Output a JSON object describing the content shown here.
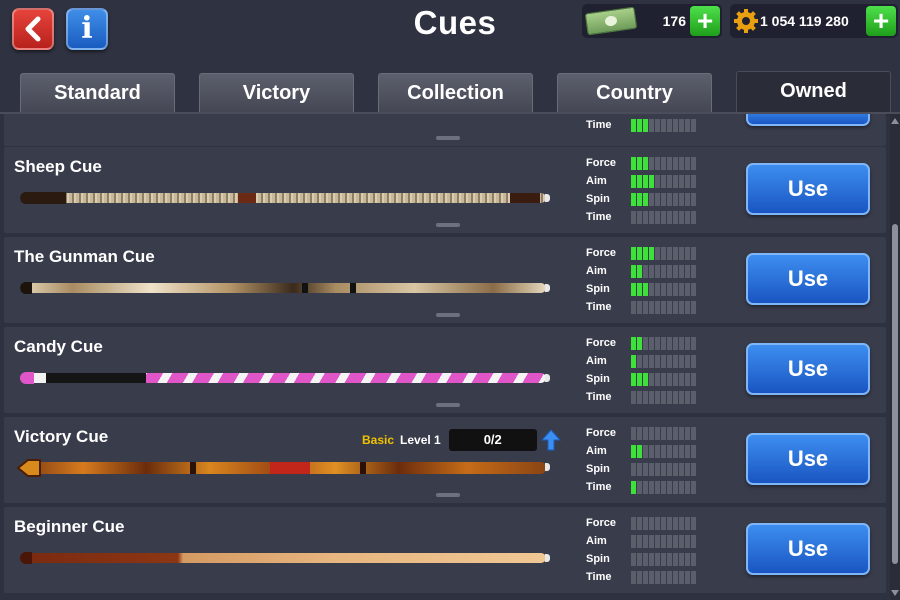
{
  "header": {
    "title": "Cues",
    "cash": "176",
    "coins": "1 054 119 280",
    "back_icon": "back-arrow-icon",
    "info_icon": "info-icon"
  },
  "tabs": [
    {
      "label": "Standard",
      "active": false
    },
    {
      "label": "Victory",
      "active": false
    },
    {
      "label": "Collection",
      "active": false
    },
    {
      "label": "Country",
      "active": false
    },
    {
      "label": "Owned",
      "active": true
    }
  ],
  "stat_labels": [
    "Force",
    "Aim",
    "Spin",
    "Time"
  ],
  "partial_row": {
    "time_bars": 3
  },
  "cues": [
    {
      "name": "Sheep Cue",
      "force": 3,
      "aim": 4,
      "spin": 3,
      "time": 0,
      "button": "Use"
    },
    {
      "name": "The Gunman Cue",
      "force": 4,
      "aim": 2,
      "spin": 3,
      "time": 0,
      "button": "Use"
    },
    {
      "name": "Candy Cue",
      "force": 2,
      "aim": 1,
      "spin": 3,
      "time": 0,
      "button": "Use"
    },
    {
      "name": "Victory Cue",
      "force": 0,
      "aim": 2,
      "spin": 0,
      "time": 1,
      "button": "Use",
      "level_type": "Basic",
      "level": "Level 1",
      "progress": "0/2"
    },
    {
      "name": "Beginner Cue",
      "force": 0,
      "aim": 0,
      "spin": 0,
      "time": 0,
      "button": "Use"
    }
  ],
  "colors": {
    "stat_on": "#3ee13a",
    "stat_off": "#5b5e6b",
    "use_button": "#2a6fdc",
    "level_basic": "#f2c200"
  }
}
